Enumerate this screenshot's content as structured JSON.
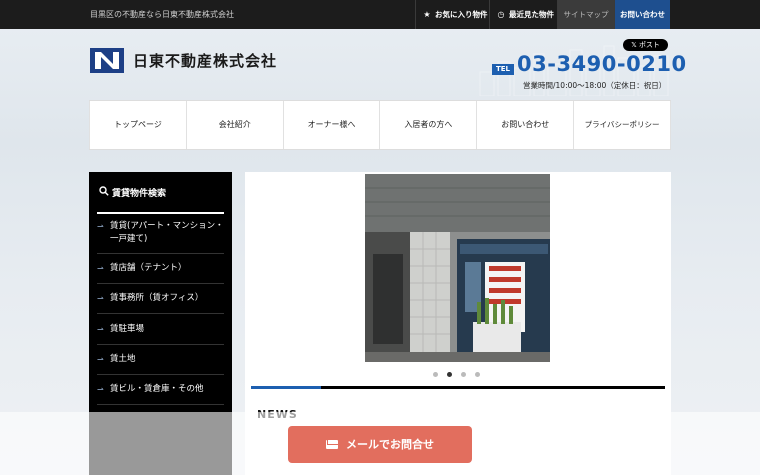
{
  "topbar": {
    "tagline": "目黒区の不動産なら日東不動産株式会社",
    "favorites": "お気に入り物件",
    "recent": "最近見た物件",
    "sitemap": "サイトマップ",
    "contact": "お問い合わせ",
    "favorites_icon": "star-icon",
    "recent_icon": "clock-icon"
  },
  "header": {
    "company_name": "日東不動産株式会社",
    "post_button": "ポスト",
    "tel_label": "TEL",
    "tel_number": "03-3490-0210",
    "hours": "営業時間/10:00～18:00（定休日：祝日）"
  },
  "nav": {
    "items": [
      "トップページ",
      "会社紹介",
      "オーナー様へ",
      "入居者の方へ",
      "お問い合わせ",
      "プライバシーポリシー"
    ]
  },
  "sidebar": {
    "title": "賃貸物件検索",
    "items": [
      "賃貸(アパート・マンション・一戸建て)",
      "賃店舗（テナント）",
      "賃事務所（賃オフィス）",
      "賃駐車場",
      "賃土地",
      "賃ビル・賃倉庫・その他"
    ]
  },
  "main": {
    "carousel": {
      "active_index": 1,
      "count": 4,
      "progress": 0.17
    },
    "news_title": "NEWS"
  },
  "floating": {
    "mail_button": "メールでお問合せ"
  },
  "colors": {
    "brand_blue": "#1d5fb0",
    "mail_button": "#e26e5e",
    "sidebar_bg": "#000000"
  }
}
